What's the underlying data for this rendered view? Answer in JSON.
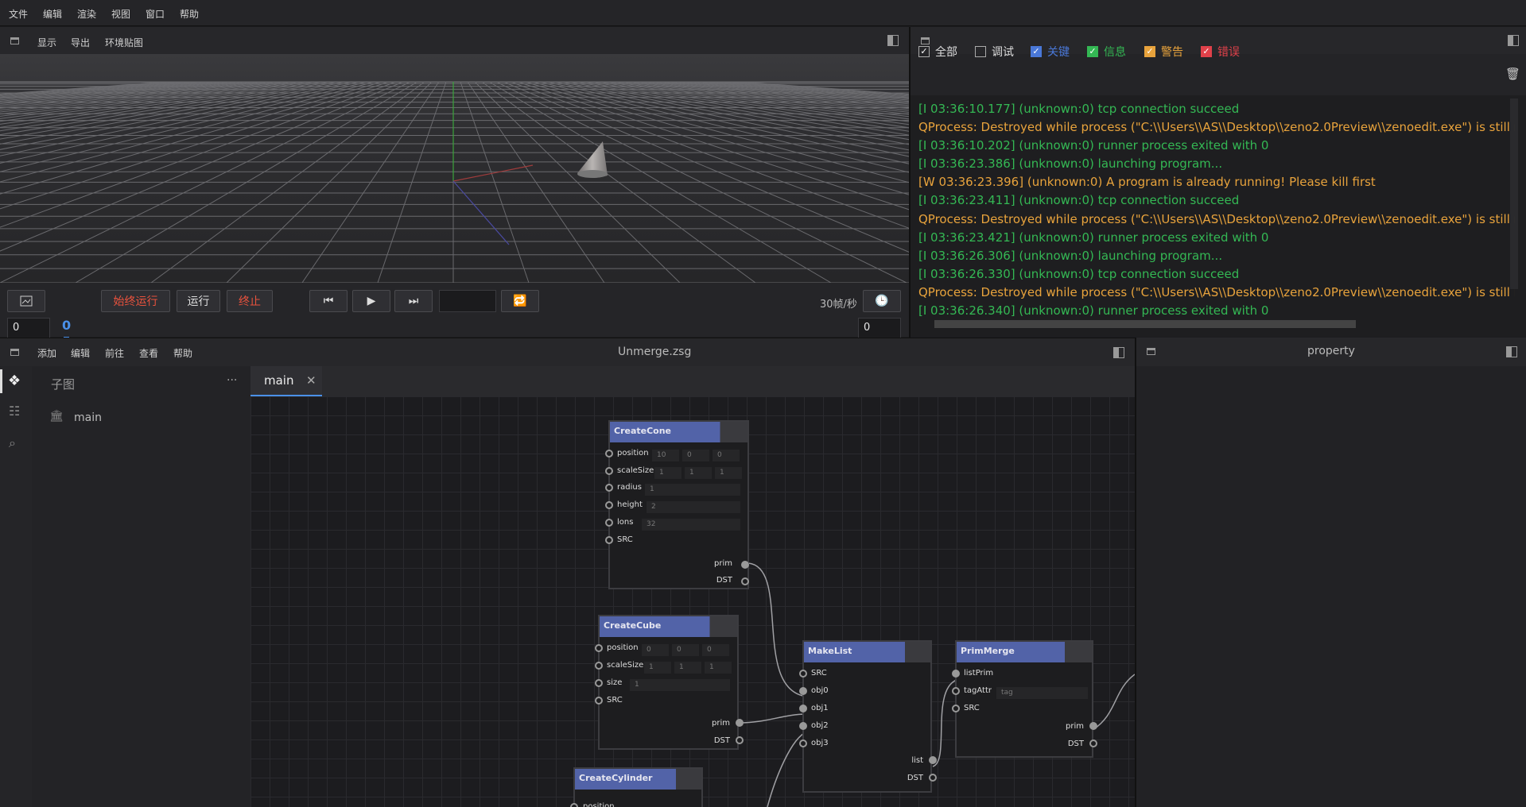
{
  "menu": [
    "文件",
    "编辑",
    "渲染",
    "视图",
    "窗口",
    "帮助"
  ],
  "viewport": {
    "toolbar": [
      "显示",
      "导出",
      "环境贴图"
    ],
    "buttons": {
      "always_run": "始终运行",
      "run": "运行",
      "stop": "终止"
    },
    "fps": "30帧/秒",
    "frame_start": "0",
    "frame_end": "0",
    "current_frame": "0"
  },
  "log": {
    "filters": [
      {
        "label": "全部",
        "checked": true,
        "color": "#dddddd"
      },
      {
        "label": "调试",
        "checked": false,
        "color": "#dddddd"
      },
      {
        "label": "关键",
        "checked": true,
        "color": "#4a78d8"
      },
      {
        "label": "信息",
        "checked": true,
        "color": "#34b854"
      },
      {
        "label": "警告",
        "checked": true,
        "color": "#e8a33c"
      },
      {
        "label": "错误",
        "checked": true,
        "color": "#e0414a"
      }
    ],
    "lines": [
      {
        "t": "[I 03:36:10.177] (unknown:0) tcp connection succeed",
        "c": "green"
      },
      {
        "t": "QProcess: Destroyed while process (\"C:\\\\Users\\\\AS\\\\Desktop\\\\zeno2.0Preview\\\\zenoedit.exe\") is still ru",
        "c": "orange"
      },
      {
        "t": "[I 03:36:10.202] (unknown:0) runner process exited with 0",
        "c": "green"
      },
      {
        "t": "[I 03:36:23.386] (unknown:0) launching program...",
        "c": "green"
      },
      {
        "t": "[W 03:36:23.396] (unknown:0) A program is already running! Please kill first",
        "c": "orange"
      },
      {
        "t": "[I 03:36:23.411] (unknown:0) tcp connection succeed",
        "c": "green"
      },
      {
        "t": "QProcess: Destroyed while process (\"C:\\\\Users\\\\AS\\\\Desktop\\\\zeno2.0Preview\\\\zenoedit.exe\") is still ru",
        "c": "orange"
      },
      {
        "t": "[I 03:36:23.421] (unknown:0) runner process exited with 0",
        "c": "green"
      },
      {
        "t": "[I 03:36:26.306] (unknown:0) launching program...",
        "c": "green"
      },
      {
        "t": "[I 03:36:26.330] (unknown:0) tcp connection succeed",
        "c": "green"
      },
      {
        "t": "QProcess: Destroyed while process (\"C:\\\\Users\\\\AS\\\\Desktop\\\\zeno2.0Preview\\\\zenoedit.exe\") is still ru",
        "c": "orange"
      },
      {
        "t": "[I 03:36:26.340] (unknown:0) runner process exited with 0",
        "c": "green"
      }
    ]
  },
  "editor": {
    "menu": [
      "添加",
      "编辑",
      "前往",
      "查看",
      "帮助"
    ],
    "file": "Unmerge.zsg",
    "subgraph_title": "子图",
    "subgraph_item": "main",
    "tab": "main",
    "more": "···"
  },
  "property": {
    "title": "property"
  },
  "nodes": {
    "cone": {
      "title": "CreateCone",
      "position": [
        "10",
        "0",
        "0"
      ],
      "scaleSize": [
        "1",
        "1",
        "1"
      ],
      "radius": "1",
      "height": "2",
      "lons": "32",
      "labels": [
        "position",
        "scaleSize",
        "radius",
        "height",
        "lons",
        "SRC",
        "prim",
        "DST"
      ]
    },
    "cube": {
      "title": "CreateCube",
      "position": [
        "0",
        "0",
        "0"
      ],
      "scaleSize": [
        "1",
        "1",
        "1"
      ],
      "size": "1",
      "labels": [
        "position",
        "scaleSize",
        "size",
        "SRC",
        "prim",
        "DST"
      ]
    },
    "cyl": {
      "title": "CreateCylinder",
      "labels": [
        "position"
      ]
    },
    "makelist": {
      "title": "MakeList",
      "labels": [
        "SRC",
        "obj0",
        "obj1",
        "obj2",
        "obj3",
        "list",
        "DST"
      ]
    },
    "merge": {
      "title": "PrimMerge",
      "labels": [
        "listPrim",
        "tagAttr",
        "SRC",
        "prim",
        "DST"
      ],
      "tag": "tag"
    }
  }
}
